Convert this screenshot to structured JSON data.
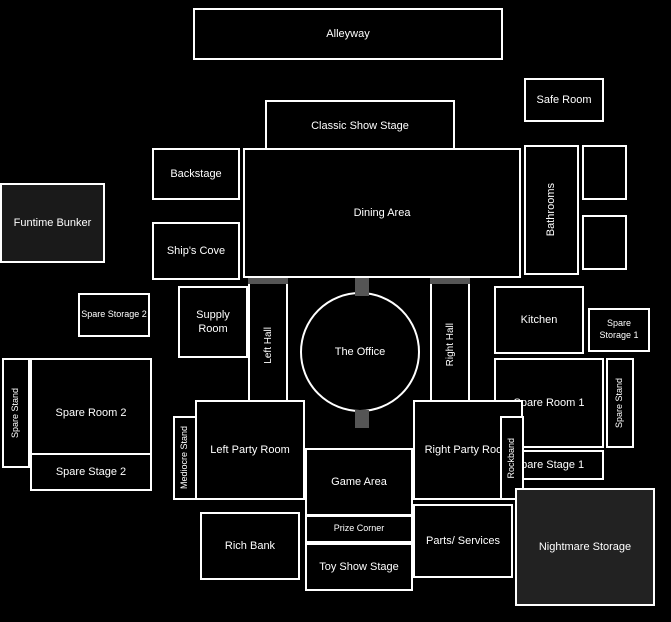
{
  "rooms": {
    "alleyway": {
      "label": "Alleyway"
    },
    "classic_show_stage": {
      "label": "Classic Show Stage"
    },
    "safe_room": {
      "label": "Safe Room"
    },
    "backstage": {
      "label": "Backstage"
    },
    "dining_area": {
      "label": "Dining Area"
    },
    "bathrooms": {
      "label": "Bathrooms"
    },
    "funtime_bunker": {
      "label": "Funtime Bunker"
    },
    "ships_cove": {
      "label": "Ship's Cove"
    },
    "supply_room": {
      "label": "Supply Room"
    },
    "left_hall": {
      "label": "Left Hall"
    },
    "right_hall": {
      "label": "Right Hall"
    },
    "the_office": {
      "label": "The Office"
    },
    "kitchen": {
      "label": "Kitchen"
    },
    "spare_storage_1": {
      "label": "Spare Storage 1"
    },
    "spare_storage_2": {
      "label": "Spare Storage 2"
    },
    "spare_room_1": {
      "label": "Spare Room 1"
    },
    "spare_room_2": {
      "label": "Spare Room 2"
    },
    "spare_stand_left": {
      "label": "Spare Stand"
    },
    "spare_stand_right": {
      "label": "Spare Stand"
    },
    "spare_stage_1": {
      "label": "Spare Stage 1"
    },
    "spare_stage_2": {
      "label": "Spare Stage 2"
    },
    "left_party_room": {
      "label": "Left Party Room"
    },
    "right_party_room": {
      "label": "Right Party Room"
    },
    "mediocre_stand": {
      "label": "Mediocre Stand"
    },
    "rockband": {
      "label": "Rockband"
    },
    "game_area": {
      "label": "Game Area"
    },
    "rich_bank": {
      "label": "Rich Bank"
    },
    "prize_corner": {
      "label": "Prize Corner"
    },
    "toy_show_stage": {
      "label": "Toy Show Stage"
    },
    "parts_services": {
      "label": "Parts/ Services"
    },
    "nightmare_storage": {
      "label": "Nightmare Storage"
    }
  }
}
